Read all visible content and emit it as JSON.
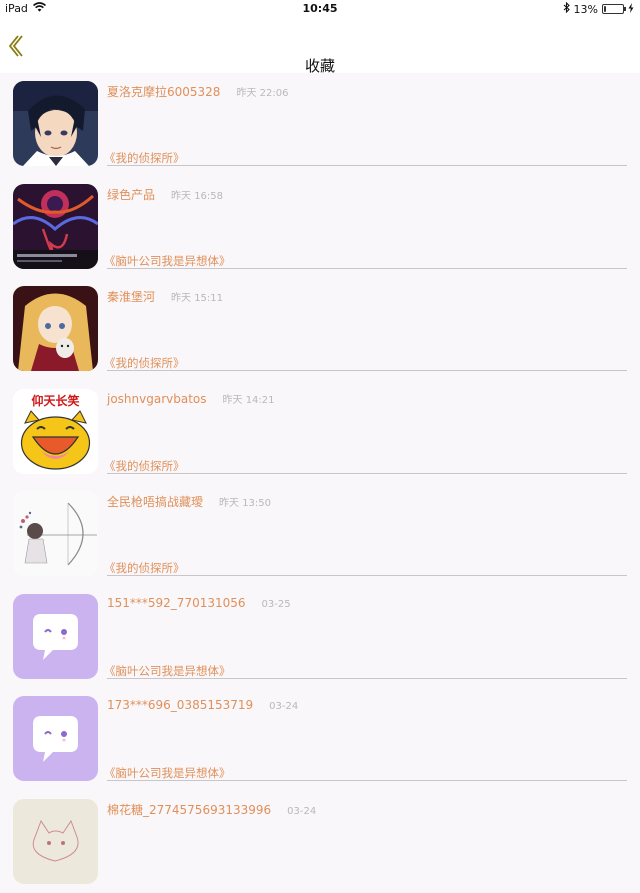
{
  "status_bar": {
    "device": "iPad",
    "time": "10:45",
    "battery_text": "13%",
    "battery_level": 0.13,
    "icons": [
      "wifi-icon",
      "bluetooth-icon",
      "battery-icon",
      "charging-icon"
    ]
  },
  "nav": {
    "back_icon": "chevron-left-icon",
    "title": "收藏"
  },
  "colors": {
    "accent": "#e0905a",
    "time_gray": "#b9b9b9",
    "back_arrow": "#8a7a10",
    "divider": "#c9c6c9"
  },
  "favorites": [
    {
      "name": "夏洛克摩拉6005328",
      "time": "昨天 22:06",
      "book": "《我的侦探所》",
      "avatar": "anime-man-avatar"
    },
    {
      "name": "绿色产品",
      "time": "昨天 16:58",
      "book": "《脑叶公司我是异想体》",
      "avatar": "dark-art-avatar"
    },
    {
      "name": "秦淮堡河",
      "time": "昨天 15:11",
      "book": "《我的侦探所》",
      "avatar": "anime-girl-avatar"
    },
    {
      "name": "joshnvgarvbatos",
      "time": "昨天 14:21",
      "book": "《我的侦探所》",
      "avatar": "laughing-cat-avatar",
      "avatar_caption": "仰天长笑"
    },
    {
      "name": "全民枪唔搞战藏璦",
      "time": "昨天 13:50",
      "book": "《我的侦探所》",
      "avatar": "sketch-archer-avatar"
    },
    {
      "name": "151***592_770131056",
      "time": "03-25",
      "book": "《脑叶公司我是异想体》",
      "avatar": "default-purple-avatar"
    },
    {
      "name": "173***696_0385153719",
      "time": "03-24",
      "book": "《脑叶公司我是异想体》",
      "avatar": "default-purple-avatar"
    },
    {
      "name": "棉花糖_2774575693133996",
      "time": "03-24",
      "book": "",
      "avatar": "sketch-cat-avatar"
    }
  ]
}
